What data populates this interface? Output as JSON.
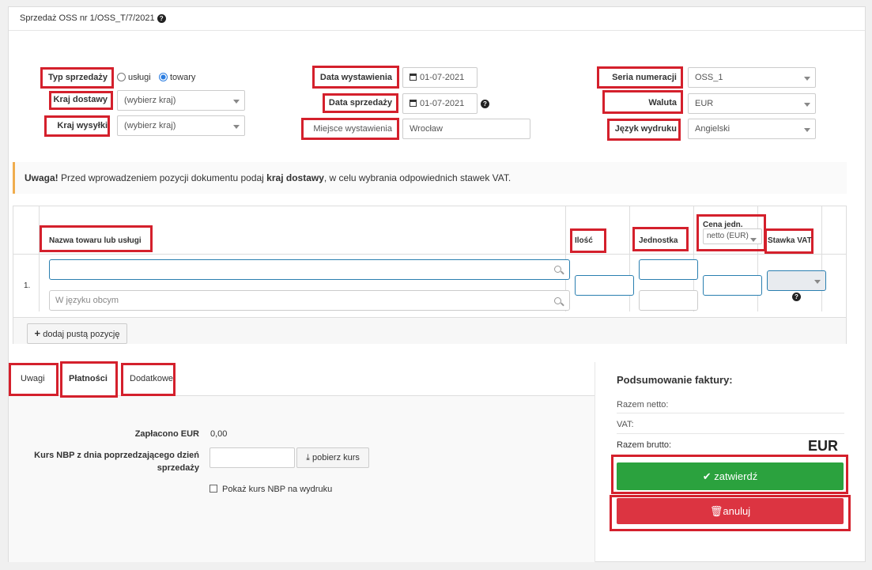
{
  "header": {
    "title": "Sprzedaż OSS nr 1/OSS_T/7/2021"
  },
  "form": {
    "sale_type": {
      "label": "Typ sprzedaży",
      "options": [
        "usługi",
        "towary"
      ],
      "selected": "towary"
    },
    "delivery_country": {
      "label": "Kraj dostawy",
      "value": "(wybierz kraj)"
    },
    "shipping_country": {
      "label": "Kraj wysyłki",
      "value": "(wybierz kraj)"
    },
    "issue_date": {
      "label": "Data wystawienia",
      "value": "01-07-2021"
    },
    "sale_date": {
      "label": "Data sprzedaży",
      "value": "01-07-2021"
    },
    "issue_place": {
      "label": "Miejsce wystawienia",
      "value": "Wrocław"
    },
    "numbering": {
      "label": "Seria numeracji",
      "value": "OSS_1"
    },
    "currency": {
      "label": "Waluta",
      "value": "EUR"
    },
    "print_lang": {
      "label": "Język wydruku",
      "value": "Angielski"
    }
  },
  "alert": {
    "strong": "Uwaga!",
    "text1": " Przed wprowadzeniem pozycji dokumentu podaj ",
    "bold": "kraj dostawy",
    "text2": ", w celu wybrania odpowiednich stawek VAT."
  },
  "table": {
    "col_name": "Nazwa towaru lub usługi",
    "col_qty": "Ilość",
    "col_unit": "Jednostka",
    "col_price": "Cena jedn.",
    "price_mode": "netto (EUR)",
    "col_vat": "Stawka VAT",
    "row_no": "1.",
    "foreign_placeholder": "W języku obcym",
    "add_row": "dodaj pustą pozycję"
  },
  "tabs": [
    "Uwagi",
    "Płatności",
    "Dodatkowe"
  ],
  "payments": {
    "paid_label": "Zapłacono EUR",
    "paid_value": "0,00",
    "rate_label_1": "Kurs NBP z dnia poprzedzającego dzień",
    "rate_label_2": "sprzedaży",
    "fetch_rate": "pobierz kurs",
    "show_rate": "Pokaż kurs NBP na wydruku"
  },
  "summary": {
    "title": "Podsumowanie faktury:",
    "net": "Razem netto:",
    "vat": "VAT:",
    "gross": "Razem brutto:",
    "currency": "EUR",
    "confirm": "zatwierdź",
    "cancel": "anuluj"
  },
  "colors": {
    "annotation": "#d4202c",
    "confirm": "#2ba23e",
    "cancel": "#dc3441",
    "accent": "#2b7de0"
  }
}
